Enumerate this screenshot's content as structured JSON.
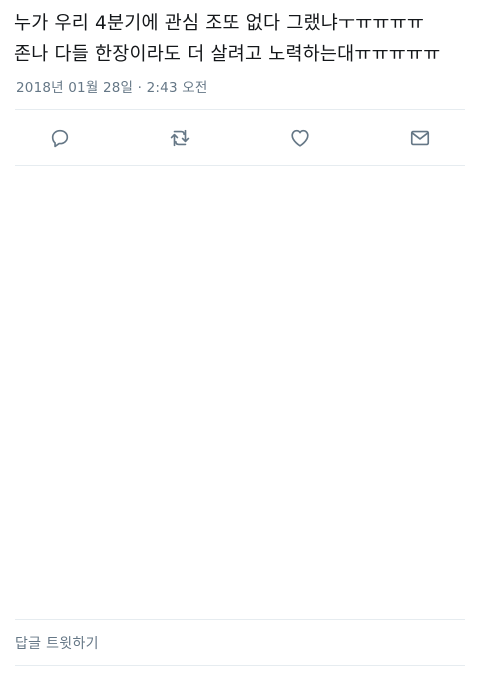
{
  "tweet": {
    "text": "누가 우리 4분기에 관심 조또 없다 그랬냐ㅜㅠㅠㅠㅠ\n존나 다들 한장이라도 더 살려고 노력하는대ㅠㅠㅠㅠㅠ",
    "timestamp": "2018년 01월 28일 · 2:43 오전"
  },
  "actions": {
    "reply_icon": "reply-icon",
    "retweet_icon": "retweet-icon",
    "like_icon": "heart-icon",
    "dm_icon": "envelope-icon",
    "icon_color": "#657786"
  },
  "reply_box": {
    "placeholder": "답글 트윗하기"
  }
}
